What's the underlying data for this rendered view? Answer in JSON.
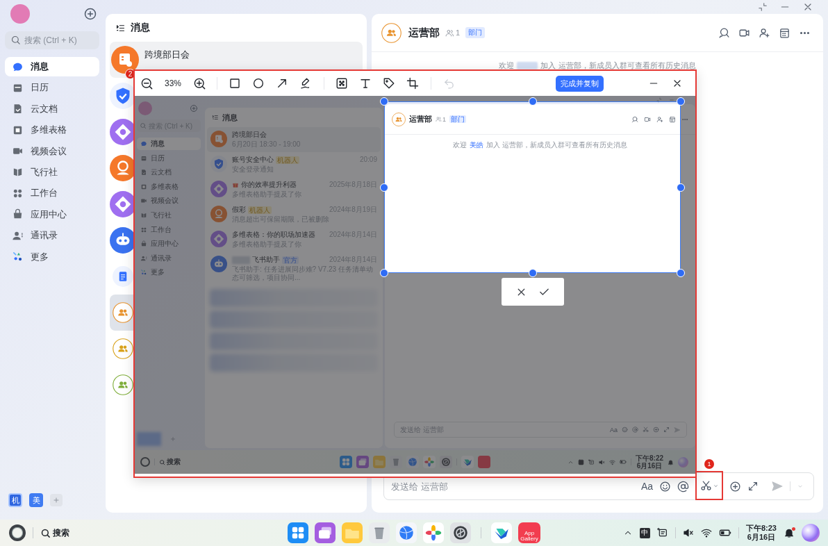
{
  "sidebar": {
    "search": {
      "placeholder": "搜索 (Ctrl + K)"
    },
    "items": [
      {
        "label": "消息",
        "selected": true
      },
      {
        "label": "日历",
        "selected": false
      },
      {
        "label": "云文档",
        "selected": false
      },
      {
        "label": "多维表格",
        "selected": false
      },
      {
        "label": "视频会议",
        "selected": false
      },
      {
        "label": "飞行社",
        "selected": false
      },
      {
        "label": "工作台",
        "selected": false
      },
      {
        "label": "应用中心",
        "selected": false
      },
      {
        "label": "通讯录",
        "selected": false
      },
      {
        "label": "更多",
        "selected": false
      }
    ],
    "accounts": [
      {
        "label": "机",
        "selected": true
      },
      {
        "label": "美",
        "selected": false
      }
    ]
  },
  "message_list": {
    "title": "消息",
    "items": [
      {
        "kind": "meeting",
        "title": "跨境部日会",
        "badge": "2"
      },
      {
        "kind": "chat",
        "selected": false
      },
      {
        "kind": "chat",
        "selected": false
      },
      {
        "kind": "chat",
        "selected": false
      },
      {
        "kind": "chat",
        "selected": false
      },
      {
        "kind": "chat",
        "selected": false
      },
      {
        "kind": "chat",
        "selected": false
      },
      {
        "kind": "chat",
        "selected": true
      },
      {
        "kind": "chat",
        "selected": false
      },
      {
        "kind": "chat",
        "selected": false
      }
    ]
  },
  "chat": {
    "title": "运营部",
    "member_count": "1",
    "tag": "部门",
    "welcome_start": "欢迎",
    "welcome_end": "加入 运营部，新成员入群可查看所有历史消息",
    "input": {
      "placeholder": "发送给 运营部",
      "format_label": "Aa",
      "send_disabled": true,
      "screenshot_tool": {
        "highlighted": true,
        "marker": "1"
      }
    }
  },
  "capture": {
    "zoom": "33%",
    "undo_disabled": true,
    "done_label": "完成并复制",
    "screenshot": {
      "sidebar": {
        "search_placeholder": "搜索 (Ctrl + K)",
        "items": [
          {
            "label": "消息",
            "selected": true
          },
          {
            "label": "日历",
            "selected": false
          },
          {
            "label": "云文档",
            "selected": false
          },
          {
            "label": "多维表格",
            "selected": false
          },
          {
            "label": "视频会议",
            "selected": false
          },
          {
            "label": "飞行社",
            "selected": false
          },
          {
            "label": "工作台",
            "selected": false
          },
          {
            "label": "应用中心",
            "selected": false
          },
          {
            "label": "通讯录",
            "selected": false
          },
          {
            "label": "更多",
            "selected": false
          }
        ]
      },
      "message_list": {
        "title": "消息",
        "items": [
          {
            "kind": "meeting",
            "title": "跨境部日会",
            "preview": "6月20日 18:30 - 19:00"
          },
          {
            "kind": "chat",
            "title": "账号安全中心",
            "tag": {
              "label": "机器人",
              "kind": "robot"
            },
            "time": "20:09",
            "preview": "安全登录通知"
          },
          {
            "kind": "chat",
            "title": "你的效率提升利器",
            "time": "2025年8月18日",
            "preview": "多维表格助手提及了你"
          },
          {
            "kind": "chat",
            "title": "假彩",
            "tag": {
              "label": "机器人",
              "kind": "robot"
            },
            "time": "2024年8月19日",
            "preview": "消息超出可保留期限，已被删除"
          },
          {
            "kind": "chat",
            "title": "多维表格：你的职场加速器",
            "time": "2024年8月14日",
            "preview": "多维表格助手提及了你"
          },
          {
            "kind": "chat",
            "title": "飞书助手",
            "name_redacted": true,
            "tag": {
              "label": "官方",
              "kind": "official"
            },
            "time": "2024年8月14日",
            "preview": "飞书助手: 任务进展同步难? V7.23 任务清单动态可筛选，项目协同..."
          }
        ]
      },
      "chat": {
        "title": "运营部",
        "member_count": "1",
        "tag": "部门",
        "welcome_start": "欢迎",
        "welcome_name": "美皓",
        "welcome_end": "加入 运营部，新成员入群可查看所有历史消息",
        "input_placeholder": "发送给 运营部",
        "format_label": "Aa"
      },
      "taskbar": {
        "search_label": "搜索",
        "time": "下午8:22",
        "date": "6月16日"
      }
    }
  },
  "taskbar": {
    "search_label": "搜索",
    "ime_label": "中",
    "app_label": "App Gallery",
    "time": "下午8:23",
    "date": "6月16日"
  }
}
